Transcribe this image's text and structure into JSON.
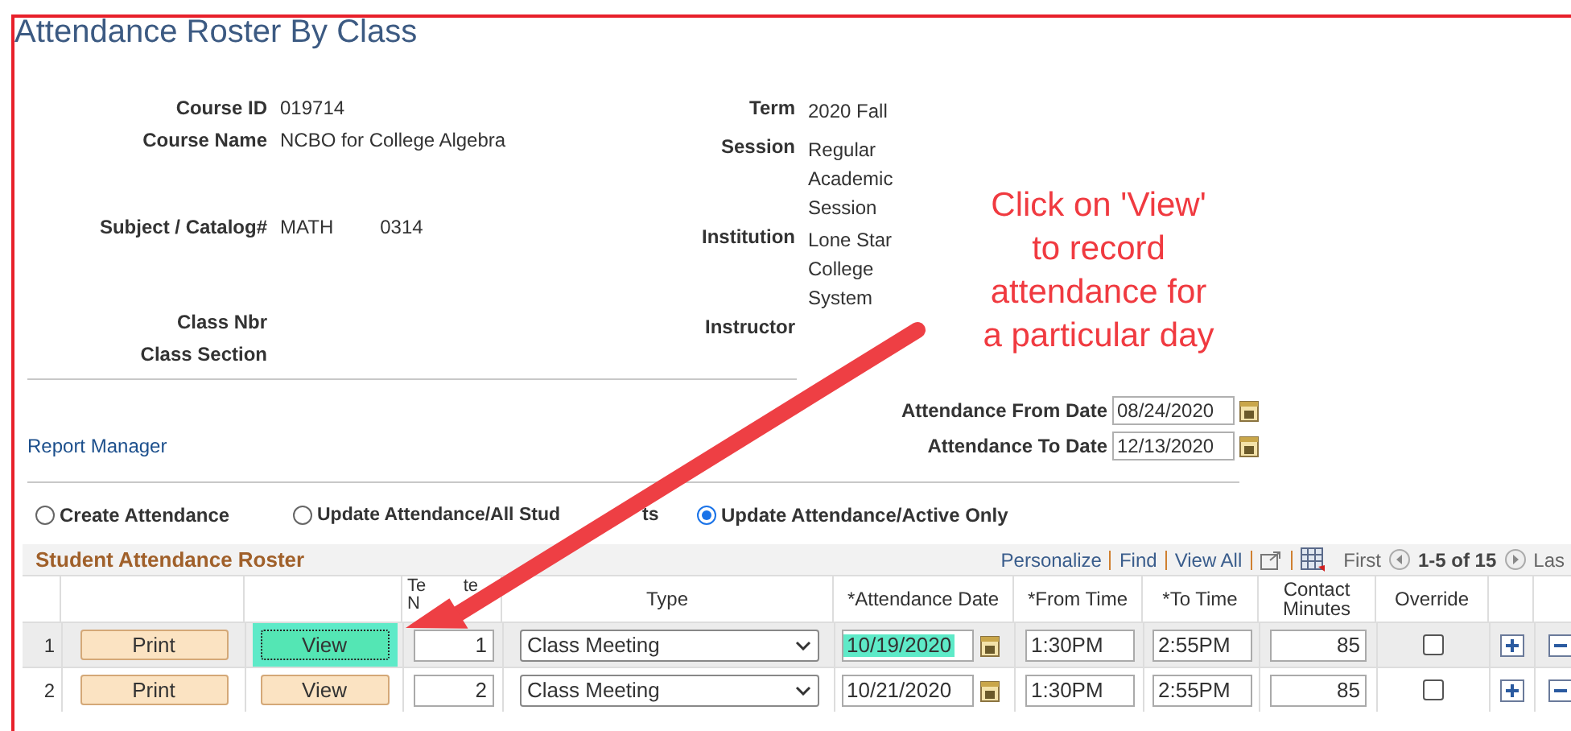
{
  "page_title": "Attendance Roster By Class",
  "left_fields": [
    {
      "label": "Course ID",
      "values": [
        "019714"
      ]
    },
    {
      "label": "Course Name",
      "values": [
        "NCBO for College Algebra"
      ]
    },
    {
      "label": "Subject / Catalog#",
      "values": [
        "MATH",
        "0314"
      ]
    },
    {
      "label": "Class Nbr"
    },
    {
      "label": "Class Section"
    }
  ],
  "right_fields": [
    {
      "label": "Term",
      "value": "2020 Fall"
    },
    {
      "label": "Session",
      "value": "Regular Academic Session"
    },
    {
      "label": "Institution",
      "value": "Lone Star College System"
    },
    {
      "label": "Instructor"
    }
  ],
  "date_fields": [
    {
      "label": "Attendance From Date",
      "value": "08/24/2020"
    },
    {
      "label": "Attendance To Date",
      "value": "12/13/2020"
    }
  ],
  "report_link": "Report Manager",
  "modes": [
    {
      "label": "Create Attendance",
      "selected": false
    },
    {
      "label": "Update Attendance/All Stud",
      "label_end": "ts",
      "selected": false
    },
    {
      "label": "Update Attendance/Active Only",
      "selected": true
    }
  ],
  "grid": {
    "title": "Student Attendance Roster",
    "links": [
      "Personalize",
      "Find",
      "View All"
    ],
    "nav": {
      "first": "First",
      "range": "1-5 of 15",
      "last": "Las"
    },
    "columns": [
      "",
      "",
      "",
      {
        "fragments": [
          "Te",
          "te",
          "N"
        ]
      },
      "Type",
      "*Attendance Date",
      "*From Time",
      "*To Time",
      "Contact Minutes",
      "Override",
      "",
      ""
    ],
    "rows": [
      {
        "number": "1",
        "print": "Print",
        "view": "View",
        "view_highlighted": true,
        "template": "1",
        "type": "Class Meeting",
        "date": "10/19/2020",
        "date_highlighted": true,
        "from": "1:30PM",
        "to": "2:55PM",
        "minutes": "85",
        "override": false,
        "current": true
      },
      {
        "number": "2",
        "print": "Print",
        "view": "View",
        "view_highlighted": false,
        "template": "2",
        "type": "Class Meeting",
        "date": "10/21/2020",
        "date_highlighted": false,
        "from": "1:30PM",
        "to": "2:55PM",
        "minutes": "85",
        "override": false,
        "current": false
      }
    ]
  },
  "callout": "Click on 'View'\nto record\nattendance for\na particular day"
}
